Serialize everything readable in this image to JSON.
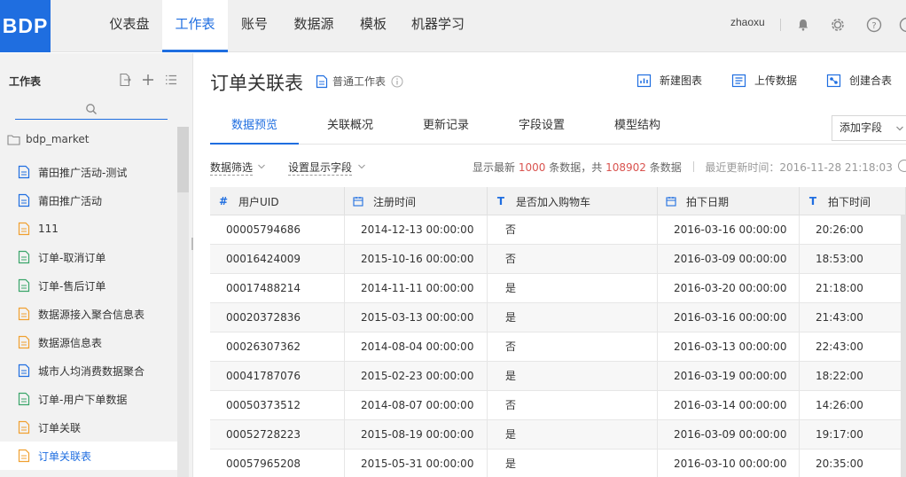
{
  "app": {
    "logo": "BDP",
    "user": "zhaoxu"
  },
  "nav": [
    {
      "label": "仪表盘"
    },
    {
      "label": "工作表"
    },
    {
      "label": "账号"
    },
    {
      "label": "数据源"
    },
    {
      "label": "模板"
    },
    {
      "label": "机器学习"
    }
  ],
  "top_icons": [
    "bell-icon",
    "gear-icon",
    "help-icon",
    "more-icon"
  ],
  "sidebar": {
    "title": "工作表",
    "folder": "bdp_market",
    "items": [
      {
        "label": "莆田推广活动-测试",
        "icon": "sheet-blue"
      },
      {
        "label": "莆田推广活动",
        "icon": "sheet-blue"
      },
      {
        "label": "111",
        "icon": "sheet-orange"
      },
      {
        "label": "订单-取消订单",
        "icon": "sheet-green"
      },
      {
        "label": "订单-售后订单",
        "icon": "sheet-green"
      },
      {
        "label": "数据源接入聚合信息表",
        "icon": "sheet-orange"
      },
      {
        "label": "数据源信息表",
        "icon": "sheet-orange"
      },
      {
        "label": "城市人均消费数据聚合",
        "icon": "sheet-blue"
      },
      {
        "label": "订单-用户下单数据",
        "icon": "sheet-green"
      },
      {
        "label": "订单关联",
        "icon": "sheet-orange"
      },
      {
        "label": "订单关联表",
        "icon": "sheet-orange"
      }
    ]
  },
  "header": {
    "title": "订单关联表",
    "sheet_type": "普通工作表",
    "actions": {
      "new_chart": "新建图表",
      "upload": "上传数据",
      "merge": "创建合表"
    }
  },
  "tabs": [
    {
      "label": "数据预览"
    },
    {
      "label": "关联概况"
    },
    {
      "label": "更新记录"
    },
    {
      "label": "字段设置"
    },
    {
      "label": "模型结构"
    }
  ],
  "add_field": "添加字段",
  "filters": {
    "data_filter": "数据筛选",
    "display_fields": "设置显示字段"
  },
  "stats": {
    "prefix": "显示最新",
    "shown": "1000",
    "mid": "条数据，共",
    "total": "108902",
    "suffix": "条数据",
    "updated": "最近更新时间：2016-11-28 21:18:03"
  },
  "table": {
    "columns": [
      {
        "icon": "#",
        "label": "用户UID"
      },
      {
        "icon": "cal",
        "label": "注册时间"
      },
      {
        "icon": "T",
        "label": "是否加入购物车"
      },
      {
        "icon": "cal",
        "label": "拍下日期"
      },
      {
        "icon": "T",
        "label": "拍下时间"
      }
    ],
    "rows": [
      [
        "00005794686",
        "2014-12-13 00:00:00",
        "否",
        "2016-03-16 00:00:00",
        "20:26:00"
      ],
      [
        "00016424009",
        "2015-10-16 00:00:00",
        "否",
        "2016-03-09 00:00:00",
        "18:53:00"
      ],
      [
        "00017488214",
        "2014-11-11 00:00:00",
        "是",
        "2016-03-20 00:00:00",
        "21:18:00"
      ],
      [
        "00020372836",
        "2015-03-13 00:00:00",
        "是",
        "2016-03-16 00:00:00",
        "21:43:00"
      ],
      [
        "00026307362",
        "2014-08-04 00:00:00",
        "否",
        "2016-03-13 00:00:00",
        "22:43:00"
      ],
      [
        "00041787076",
        "2015-02-23 00:00:00",
        "是",
        "2016-03-19 00:00:00",
        "18:22:00"
      ],
      [
        "00050373512",
        "2014-08-07 00:00:00",
        "否",
        "2016-03-14 00:00:00",
        "14:26:00"
      ],
      [
        "00052728223",
        "2015-08-19 00:00:00",
        "是",
        "2016-03-09 00:00:00",
        "19:17:00"
      ],
      [
        "00057965208",
        "2015-05-31 00:00:00",
        "是",
        "2016-03-10 00:00:00",
        "20:35:00"
      ]
    ]
  },
  "colors": {
    "brand": "#1f6ee0",
    "highlight_number": "#d9534f"
  }
}
